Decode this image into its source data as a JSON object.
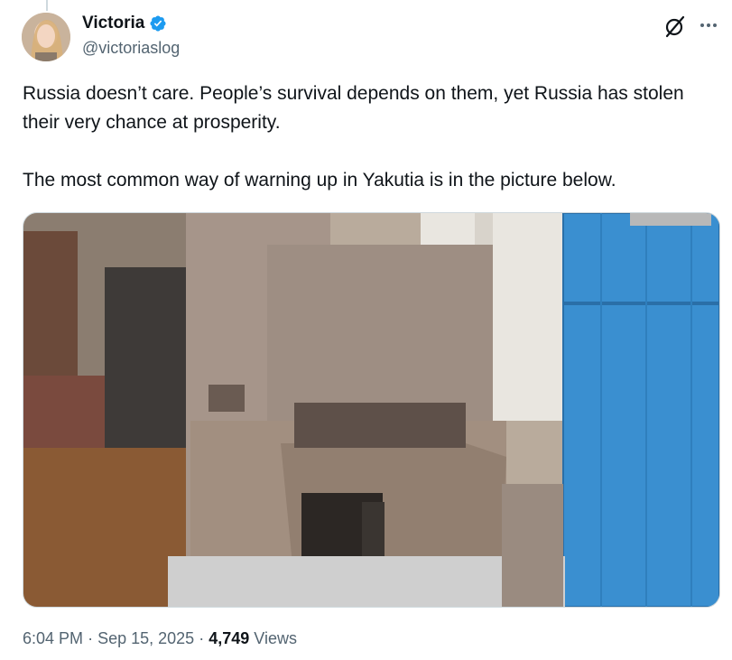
{
  "tweet": {
    "author": {
      "display_name": "Victoria",
      "handle": "@victoriaslog",
      "verified": true
    },
    "text": "Russia doesn’t care. People’s survival depends on them, yet Russia has stolen their very chance at prosperity.\n\nThe most common way of warning up in Yakutia is in the picture below.",
    "meta": {
      "time": "6:04 PM",
      "separator": "·",
      "date": "Sep 15, 2025",
      "views_count": "4,749",
      "views_label": "Views"
    }
  },
  "icons": {
    "verified": "verified-badge-icon",
    "grok": "grok-icon",
    "more": "more-options-icon"
  },
  "colors": {
    "text_primary": "#0f1419",
    "text_secondary": "#536471",
    "verified_blue": "#1d9bf0",
    "border": "#cfd9de"
  }
}
